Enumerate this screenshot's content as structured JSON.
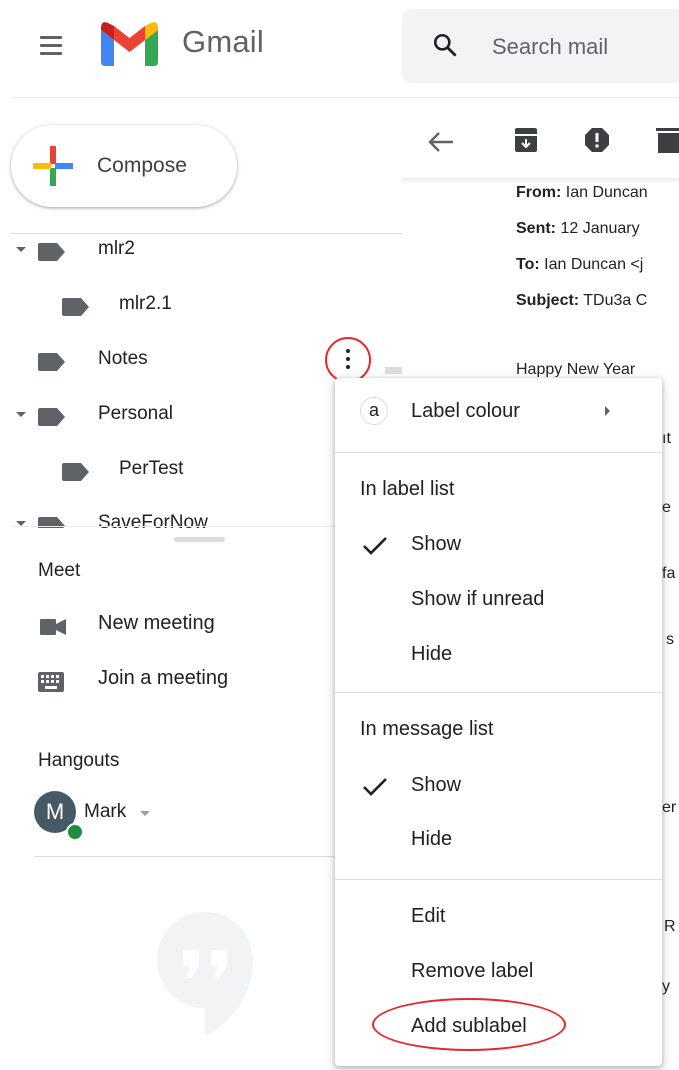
{
  "app": {
    "title": "Gmail"
  },
  "search": {
    "placeholder": "Search mail"
  },
  "compose": {
    "label": "Compose"
  },
  "labels": [
    {
      "name": "mlr2",
      "expanded": true,
      "indent": 0
    },
    {
      "name": "mlr2.1",
      "expanded": null,
      "indent": 1
    },
    {
      "name": "Notes",
      "expanded": null,
      "indent": 0
    },
    {
      "name": "Personal",
      "expanded": true,
      "indent": 0
    },
    {
      "name": "PerTest",
      "expanded": null,
      "indent": 1
    },
    {
      "name": "SaveForNow",
      "expanded": true,
      "indent": 0
    }
  ],
  "meet": {
    "title": "Meet",
    "new_meeting": "New meeting",
    "join_meeting": "Join a meeting"
  },
  "hangouts": {
    "title": "Hangouts",
    "user_initial": "M",
    "user_name": "Mark"
  },
  "email": {
    "from_key": "From:",
    "from_value": "Ian Duncan",
    "sent_key": "Sent:",
    "sent_value": "12 January",
    "to_key": "To:",
    "to_value": "Ian Duncan <j",
    "subject_key": "Subject:",
    "subject_value": "TDu3a C",
    "greeting": "Happy New Year",
    "fragments": [
      "ıt",
      "e",
      "fa",
      "s",
      "er",
      "R",
      "y"
    ]
  },
  "context_menu": {
    "label_colour": "Label colour",
    "label_colour_swatch": "a",
    "in_label_list": "In label list",
    "label_list_options": [
      "Show",
      "Show if unread",
      "Hide"
    ],
    "label_list_selected": "Show",
    "in_message_list": "In message list",
    "message_list_options": [
      "Show",
      "Hide"
    ],
    "message_list_selected": "Show",
    "edit": "Edit",
    "remove_label": "Remove label",
    "add_sublabel": "Add sublabel"
  },
  "colors": {
    "annotation_red": "#e8272b",
    "presence_green": "#1e8e3e",
    "avatar_bg": "#455a64",
    "icon_grey": "#5f6368"
  }
}
